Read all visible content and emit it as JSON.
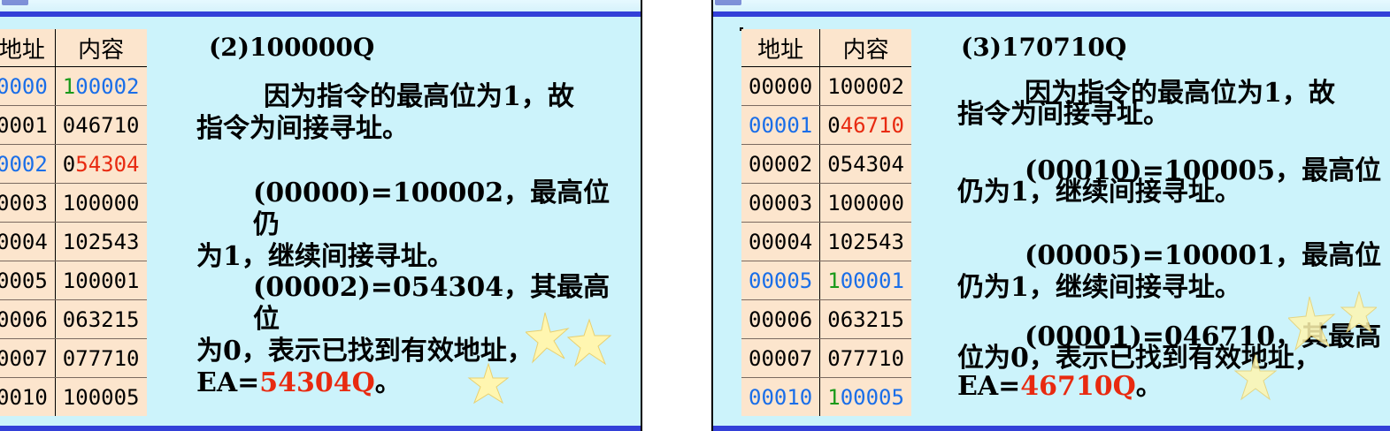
{
  "left": {
    "table": {
      "headers": [
        "地址",
        "内容"
      ],
      "rows": [
        {
          "addr": "0000",
          "content_a": "1",
          "content_b": "00002",
          "addr_color": "blue",
          "a_color": "green",
          "b_color": "blue"
        },
        {
          "addr": "0001",
          "content_a": "",
          "content_b": "046710",
          "addr_color": "",
          "a_color": "",
          "b_color": ""
        },
        {
          "addr": "0002",
          "content_a": "0",
          "content_b": "54304",
          "addr_color": "blue",
          "a_color": "",
          "b_color": "red"
        },
        {
          "addr": "0003",
          "content_a": "",
          "content_b": "100000",
          "addr_color": "",
          "a_color": "",
          "b_color": ""
        },
        {
          "addr": "0004",
          "content_a": "",
          "content_b": "102543",
          "addr_color": "",
          "a_color": "",
          "b_color": ""
        },
        {
          "addr": "0005",
          "content_a": "",
          "content_b": "100001",
          "addr_color": "",
          "a_color": "",
          "b_color": ""
        },
        {
          "addr": "0006",
          "content_a": "",
          "content_b": "063215",
          "addr_color": "",
          "a_color": "",
          "b_color": ""
        },
        {
          "addr": "0007",
          "content_a": "",
          "content_b": "077710",
          "addr_color": "",
          "a_color": "",
          "b_color": ""
        },
        {
          "addr": "0010",
          "content_a": "",
          "content_b": "100005",
          "addr_color": "",
          "a_color": "",
          "b_color": ""
        }
      ]
    },
    "heading": "(2)100000Q",
    "p1_line1": "因为指令的最高位为1，故",
    "p1_line2": "指令为间接寻址。",
    "p2_line1": "(00000)=100002，最高位仍",
    "p2_line2": "为1，继续间接寻址。",
    "p3_line1": "(00002)=054304，其最高位",
    "p3_line2": "为0，表示已找到有效地址，",
    "ea_prefix": "EA=",
    "ea_value": "54304Q",
    "ea_suffix": "。"
  },
  "right": {
    "table": {
      "headers": [
        "地址",
        "内容"
      ],
      "rows": [
        {
          "addr": "00000",
          "content_a": "",
          "content_b": "100002",
          "addr_color": "",
          "a_color": "",
          "b_color": ""
        },
        {
          "addr": "00001",
          "content_a": "0",
          "content_b": "46710",
          "addr_color": "blue",
          "a_color": "",
          "b_color": "red"
        },
        {
          "addr": "00002",
          "content_a": "",
          "content_b": "054304",
          "addr_color": "",
          "a_color": "",
          "b_color": ""
        },
        {
          "addr": "00003",
          "content_a": "",
          "content_b": "100000",
          "addr_color": "",
          "a_color": "",
          "b_color": ""
        },
        {
          "addr": "00004",
          "content_a": "",
          "content_b": "102543",
          "addr_color": "",
          "a_color": "",
          "b_color": ""
        },
        {
          "addr": "00005",
          "content_a": "1",
          "content_b": "00001",
          "addr_color": "blue",
          "a_color": "green",
          "b_color": "blue"
        },
        {
          "addr": "00006",
          "content_a": "",
          "content_b": "063215",
          "addr_color": "",
          "a_color": "",
          "b_color": ""
        },
        {
          "addr": "00007",
          "content_a": "",
          "content_b": "077710",
          "addr_color": "",
          "a_color": "",
          "b_color": ""
        },
        {
          "addr": "00010",
          "content_a": "1",
          "content_b": "00005",
          "addr_color": "blue",
          "a_color": "green",
          "b_color": "blue"
        }
      ]
    },
    "heading": "(3)170710Q",
    "p1_line1": "因为指令的最高位为1，故",
    "p1_line2": "指令为间接寻址。",
    "p2_line1": "(00010)=100005，最高位",
    "p2_line2": "仍为1，继续间接寻址。",
    "p3_line1": "(00005)=100001，最高位",
    "p3_line2": "仍为1，继续间接寻址。",
    "p4_line1": "(00001)=046710，其最高",
    "p4_line2": "位为0，表示已找到有效地址，",
    "ea_prefix": "EA=",
    "ea_value": "46710Q",
    "ea_suffix": "。"
  },
  "colors": {
    "blue": "#1a6ee8",
    "green": "#1a9a1a",
    "red": "#e82a10",
    "band": "#3340d8",
    "background": "#ccf3fb",
    "table": "#fce5cd"
  },
  "decorations": [
    "sparkle-star-icon"
  ]
}
